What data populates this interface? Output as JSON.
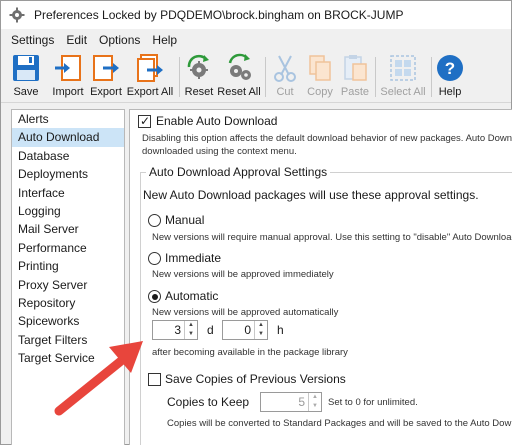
{
  "window": {
    "title": "Preferences Locked by PDQDEMO\\brock.bingham on BROCK-JUMP"
  },
  "menu": [
    "Settings",
    "Edit",
    "Options",
    "Help"
  ],
  "toolbar": {
    "save": "Save",
    "import": "Import",
    "export": "Export",
    "export_all": "Export All",
    "reset": "Reset",
    "reset_all": "Reset All",
    "cut": "Cut",
    "copy": "Copy",
    "paste": "Paste",
    "select_all": "Select All",
    "help": "Help"
  },
  "sidebar": {
    "items": [
      "Alerts",
      "Auto Download",
      "Database",
      "Deployments",
      "Interface",
      "Logging",
      "Mail Server",
      "Performance",
      "Printing",
      "Proxy Server",
      "Repository",
      "Spiceworks",
      "Target Filters",
      "Target Service"
    ],
    "selected": "Auto Download"
  },
  "content": {
    "enable_label": "Enable Auto Download",
    "enable_checked": true,
    "enable_desc_1": "Disabling this option affects the default download behavior of new packages. Auto Download",
    "enable_desc_2": "downloaded using the context menu.",
    "group_title": "Auto Download Approval Settings",
    "group_intro": "New Auto Download packages will use these approval settings.",
    "manual_label": "Manual",
    "manual_desc": "New versions will require manual approval. Use this setting to \"disable\" Auto Download",
    "immediate_label": "Immediate",
    "immediate_desc": "New versions will be approved immediately",
    "automatic_label": "Automatic",
    "automatic_desc": "New versions will be approved automatically",
    "selected_option": "Automatic",
    "days_value": "3",
    "days_unit": "d",
    "hours_value": "0",
    "hours_unit": "h",
    "after_text": "after becoming available in the package library",
    "save_copies_label": "Save Copies of Previous Versions",
    "save_copies_checked": false,
    "copies_label": "Copies to Keep",
    "copies_value": "5",
    "copies_hint": "Set to 0 for unlimited.",
    "copies_desc": "Copies will be converted to Standard Packages and will be saved to the Auto Downlo"
  },
  "colors": {
    "selected_bg": "#cce4f7",
    "arrow": "#e8453c",
    "help_icon": "#1f6fc4"
  }
}
